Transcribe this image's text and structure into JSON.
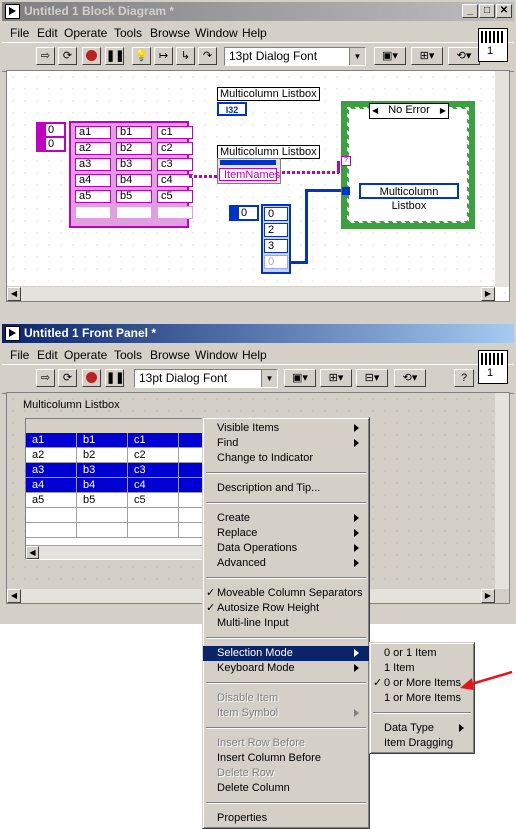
{
  "block_window": {
    "title": "Untitled 1 Block Diagram *",
    "menu": [
      "File",
      "Edit",
      "Operate",
      "Tools",
      "Browse",
      "Window",
      "Help"
    ],
    "font_combo": "13pt Dialog Font",
    "vi_icon_number": "1",
    "array_index": [
      "0",
      "0"
    ],
    "table": [
      [
        "a1",
        "b1",
        "c1"
      ],
      [
        "a2",
        "b2",
        "c2"
      ],
      [
        "a3",
        "b3",
        "c3"
      ],
      [
        "a4",
        "b4",
        "c4"
      ],
      [
        "a5",
        "b5",
        "c5"
      ]
    ],
    "listbox_label_1": "Multicolumn Listbox",
    "i32_badge": "I32",
    "listbox_label_2": "Multicolumn Listbox",
    "property_item_names": "ItemNames",
    "case_selector": "No Error",
    "case_listbox_label": "Multicolumn Listbox",
    "const_index": "0",
    "const_array": [
      "0",
      "2",
      "3",
      "0"
    ]
  },
  "front_window": {
    "title": "Untitled 1 Front Panel *",
    "menu": [
      "File",
      "Edit",
      "Operate",
      "Tools",
      "Browse",
      "Window",
      "Help"
    ],
    "font_combo": "13pt Dialog Font",
    "vi_icon_number": "1",
    "listbox_label": "Multicolumn Listbox",
    "rows": [
      {
        "cells": [
          "a1",
          "b1",
          "c1"
        ],
        "selected": true
      },
      {
        "cells": [
          "a2",
          "b2",
          "c2"
        ],
        "selected": false
      },
      {
        "cells": [
          "a3",
          "b3",
          "c3"
        ],
        "selected": true
      },
      {
        "cells": [
          "a4",
          "b4",
          "c4"
        ],
        "selected": true
      },
      {
        "cells": [
          "a5",
          "b5",
          "c5"
        ],
        "selected": false
      }
    ]
  },
  "context_menu": {
    "items": [
      {
        "label": "Visible Items",
        "submenu": true
      },
      {
        "label": "Find",
        "submenu": true
      },
      {
        "label": "Change to Indicator"
      },
      {
        "sep": true
      },
      {
        "label": "Description and Tip..."
      },
      {
        "sep": true
      },
      {
        "label": "Create",
        "submenu": true
      },
      {
        "label": "Replace",
        "submenu": true
      },
      {
        "label": "Data Operations",
        "submenu": true
      },
      {
        "label": "Advanced",
        "submenu": true
      },
      {
        "sep": true
      },
      {
        "label": "Moveable Column Separators",
        "checked": true
      },
      {
        "label": "Autosize Row Height",
        "checked": true
      },
      {
        "label": "Multi-line Input"
      },
      {
        "sep": true
      },
      {
        "label": "Selection Mode",
        "submenu": true,
        "highlighted": true
      },
      {
        "label": "Keyboard Mode",
        "submenu": true
      },
      {
        "sep": true
      },
      {
        "label": "Disable Item",
        "disabled": true
      },
      {
        "label": "Item Symbol",
        "submenu": true,
        "disabled": true
      },
      {
        "sep": true
      },
      {
        "label": "Insert Row Before",
        "disabled": true
      },
      {
        "label": "Insert Column Before"
      },
      {
        "label": "Delete Row",
        "disabled": true
      },
      {
        "label": "Delete Column"
      },
      {
        "sep": true
      },
      {
        "label": "Properties"
      }
    ]
  },
  "submenu": {
    "items": [
      {
        "label": "0 or 1 Item"
      },
      {
        "label": "1 Item"
      },
      {
        "label": "0 or More Items",
        "checked": true
      },
      {
        "label": "1 or More Items"
      },
      {
        "sep": true
      },
      {
        "label": "Data Type",
        "submenu": true
      },
      {
        "label": "Item Dragging"
      }
    ]
  },
  "colors": {
    "accent_red": "#e8141c",
    "array_pink": "#c000c0",
    "wire_blue": "#0033cc",
    "selection_blue": "#0000d4",
    "case_green": "#3ca040"
  }
}
